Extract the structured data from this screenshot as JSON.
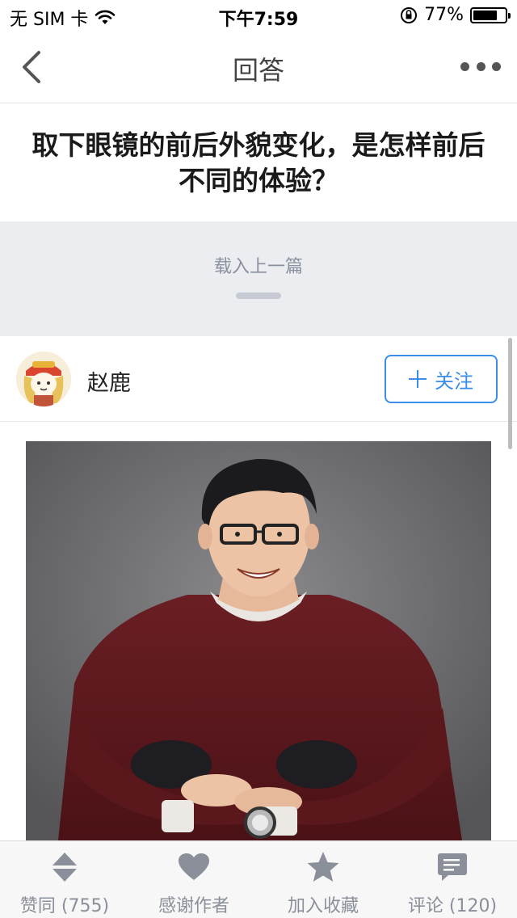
{
  "status_bar": {
    "carrier": "无 SIM 卡",
    "time": "下午7:59",
    "battery": "77%",
    "battery_level": 0.77
  },
  "nav": {
    "title": "回答"
  },
  "question": {
    "title": "取下眼镜的前后外貌变化，是怎样前后不同的体验？"
  },
  "load_prev": {
    "label": "载入上一篇"
  },
  "author": {
    "name": "赵鹿",
    "follow_label": "关注"
  },
  "toolbar": {
    "items": [
      {
        "label": "赞同 (755)",
        "icon": "vote-icon"
      },
      {
        "label": "感谢作者",
        "icon": "heart-icon"
      },
      {
        "label": "加入收藏",
        "icon": "star-icon"
      },
      {
        "label": "评论 (120)",
        "icon": "comment-icon"
      }
    ]
  },
  "colors": {
    "accent": "#3b8ee8",
    "toolbar_icon": "#8a8f99",
    "load_bg": "#ebedf1"
  }
}
